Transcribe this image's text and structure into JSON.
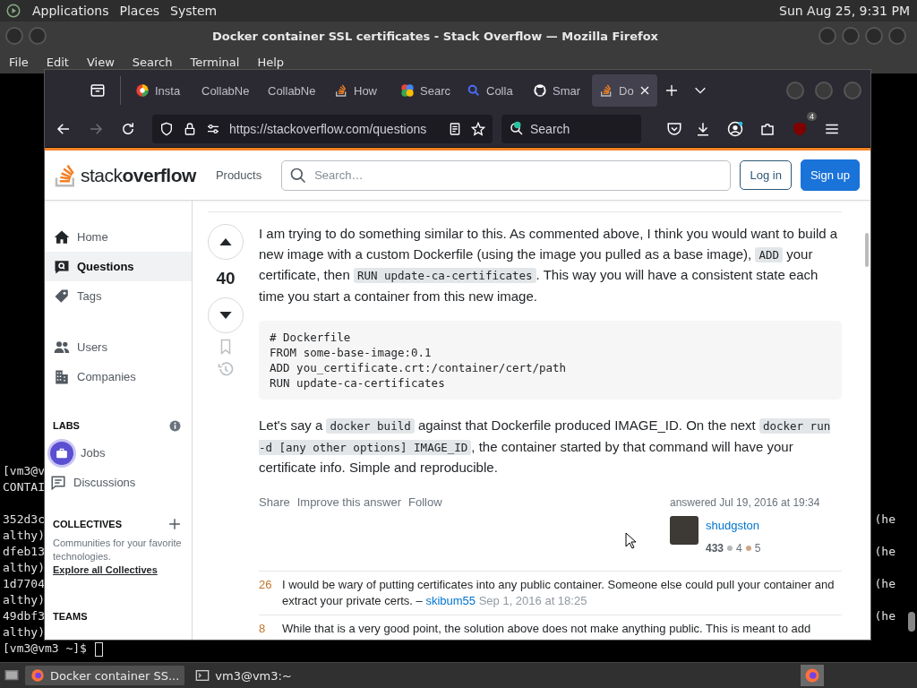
{
  "top_panel": {
    "menus": [
      "Applications",
      "Places",
      "System"
    ],
    "clock": "Sun Aug 25, 9:31 PM"
  },
  "terminal": {
    "title": "Docker container SSL certificates - Stack Overflow — Mozilla Firefox",
    "menu": [
      "File",
      "Edit",
      "View",
      "Search",
      "Terminal",
      "Help"
    ],
    "lines": [
      {
        "kind": "text",
        "left": "[vm3@v"
      },
      {
        "kind": "text",
        "left": "CONTAI"
      },
      {
        "kind": "blank"
      },
      {
        "kind": "text",
        "left": "352d3c",
        "right": "(he"
      },
      {
        "kind": "text",
        "left": "althy)"
      },
      {
        "kind": "text",
        "left": "dfeb13",
        "right": "(he"
      },
      {
        "kind": "text",
        "left": "althy)"
      },
      {
        "kind": "text",
        "left": "1d7704",
        "right": "(he"
      },
      {
        "kind": "text",
        "left": "althy)"
      },
      {
        "kind": "text",
        "left": "49dbf3",
        "right": "(he"
      },
      {
        "kind": "text",
        "left": "althy)"
      },
      {
        "kind": "prompt",
        "left": "[vm3@vm3 ~]$"
      }
    ]
  },
  "taskbar": {
    "items": [
      {
        "label": "Docker container SS...",
        "selected": true
      },
      {
        "label": "vm3@vm3:~",
        "selected": false
      }
    ]
  },
  "browser": {
    "tabs": [
      {
        "label": "Insta",
        "selected": false
      },
      {
        "label": "CollabNe",
        "selected": false
      },
      {
        "label": "CollabNe",
        "selected": false
      },
      {
        "label": "How",
        "selected": false
      },
      {
        "label": "Searc",
        "selected": false
      },
      {
        "label": "Colla",
        "selected": false
      },
      {
        "label": "Smar",
        "selected": false
      },
      {
        "label": "Do",
        "selected": true
      }
    ],
    "url": "https://stackoverflow.com/questions",
    "search_placeholder": "Search",
    "extension_badge": "4"
  },
  "site": {
    "logo": "stack**overflow**",
    "products": "Products",
    "search_placeholder": "Search…",
    "login": "Log in",
    "signup": "Sign up",
    "nav_groups": [
      [
        {
          "label": "Home",
          "selected": false
        },
        {
          "label": "Questions",
          "selected": true
        },
        {
          "label": "Tags",
          "selected": false
        }
      ],
      [
        {
          "label": "Users",
          "selected": false
        },
        {
          "label": "Companies",
          "selected": false
        }
      ]
    ],
    "labs": {
      "heading": "LABS",
      "items": [
        "Jobs",
        "Discussions"
      ]
    },
    "collectives": {
      "heading": "COLLECTIVES",
      "description": "Communities for your favorite technologies.",
      "link": "Explore all Collectives"
    },
    "teams": {
      "heading": "TEAMS"
    }
  },
  "answer": {
    "votes": "40",
    "paragraphs": [
      [
        {
          "kind": "text",
          "text": "I am trying to do something similar to this. As commented above, I think you would want to build a new image with a custom Dockerfile (using the image you pulled as a base image), "
        },
        {
          "kind": "code",
          "text": "ADD"
        },
        {
          "kind": "text",
          "text": " your certificate, then "
        },
        {
          "kind": "code",
          "text": "RUN update-ca-certificates"
        },
        {
          "kind": "text",
          "text": ". This way you will have a consistent state each time you start a container from this new image."
        }
      ],
      [
        {
          "kind": "text",
          "text": "Let's say a "
        },
        {
          "kind": "code",
          "text": "docker build"
        },
        {
          "kind": "text",
          "text": " against that Dockerfile produced IMAGE_ID. On the next "
        },
        {
          "kind": "code",
          "text": "docker run -d [any other options] IMAGE_ID"
        },
        {
          "kind": "text",
          "text": ", the container started by that command will have your certificate info. Simple and reproducible."
        }
      ]
    ],
    "code_block": [
      "# Dockerfile",
      "FROM some-base-image:0.1",
      "ADD you_certificate.crt:/container/cert/path",
      "RUN update-ca-certificates"
    ],
    "actions": [
      "Share",
      "Improve this answer",
      "Follow"
    ],
    "answered": "answered Jul 19, 2016 at 19:34",
    "user": "shudgston",
    "reputation": "433",
    "badges": [
      {
        "count": "4",
        "color": "#b4b8bc"
      },
      {
        "count": "5",
        "color": "#d1a684"
      }
    ]
  },
  "comments": [
    {
      "score": "26",
      "text": "I would be wary of putting certificates into any public container. Someone else could pull your container and extract your private certs. – ",
      "user": "skibum55",
      "date": "Sep 1, 2016 at 18:25"
    },
    {
      "score": "8",
      "text": "While that is a very good point, the solution above does not make anything public. This is meant to add"
    }
  ]
}
